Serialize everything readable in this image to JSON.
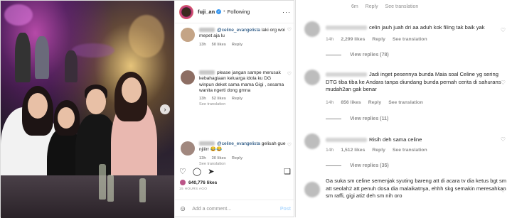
{
  "post": {
    "username": "fuji_an",
    "follow_label": "Following",
    "likes": "640,776 likes",
    "time_ago": "15 HOURS AGO",
    "add_comment_placeholder": "Add a comment...",
    "post_label": "Post"
  },
  "comments": [
    {
      "mention": "@celine_evangelista",
      "text": " laki org woi mepet aja lu",
      "time": "13h",
      "likes": "50 likes",
      "reply": "Reply",
      "see_translation": ""
    },
    {
      "mention": "",
      "text": "please jangan sampe merusak kebahagiaan keluarga idola ku DG winpun deket sama mama Gigi , sesama wanita ngerti dong gmna",
      "time": "13h",
      "likes": "52 likes",
      "reply": "Reply",
      "see_translation": "See translation"
    },
    {
      "mention": "@celine_evangelista",
      "text": " gelisah gue njiiirr 😂😂",
      "time": "13h",
      "likes": "30 likes",
      "reply": "Reply",
      "see_translation": "See translation"
    }
  ],
  "right_panel": {
    "top_meta": {
      "time": "6m",
      "reply": "Reply",
      "see_translation": "See translation"
    },
    "comments": [
      {
        "text": "celin jauh juah dri aa aduh kok filing tak baik yak",
        "time": "14h",
        "likes": "2,299 likes",
        "reply": "Reply",
        "see_translation": "See translation",
        "view_replies": "View replies (78)"
      },
      {
        "text": "Jadi inget pesennya bunda Maia soal Celine yg sering DTG tiba tiba ke Andara tanpa diundang bunda pernah cerita di sahurans mudah2an gak benar",
        "time": "14h",
        "likes": "856 likes",
        "reply": "Reply",
        "see_translation": "See translation",
        "view_replies": "View replies (11)"
      },
      {
        "text": "Risih deh sama celine",
        "time": "14h",
        "likes": "1,512 likes",
        "reply": "Reply",
        "see_translation": "See translation",
        "view_replies": "View replies (35)"
      },
      {
        "text": "Ga suka sm celine semenjak syuting bareng att di acara tv dia ketus bgt sm att seolah2 att penuh dosa dia malaikatnya, ehhh skg semakin meresahkan sm raffi, gigi ati2 deh sm nih oro",
        "time": "",
        "likes": "",
        "reply": "",
        "see_translation": "",
        "view_replies": ""
      }
    ]
  },
  "icons": [
    "heart-icon",
    "comment-icon",
    "share-icon",
    "save-icon",
    "emoji-icon",
    "more-icon",
    "verified-icon",
    "carousel-next-icon"
  ]
}
